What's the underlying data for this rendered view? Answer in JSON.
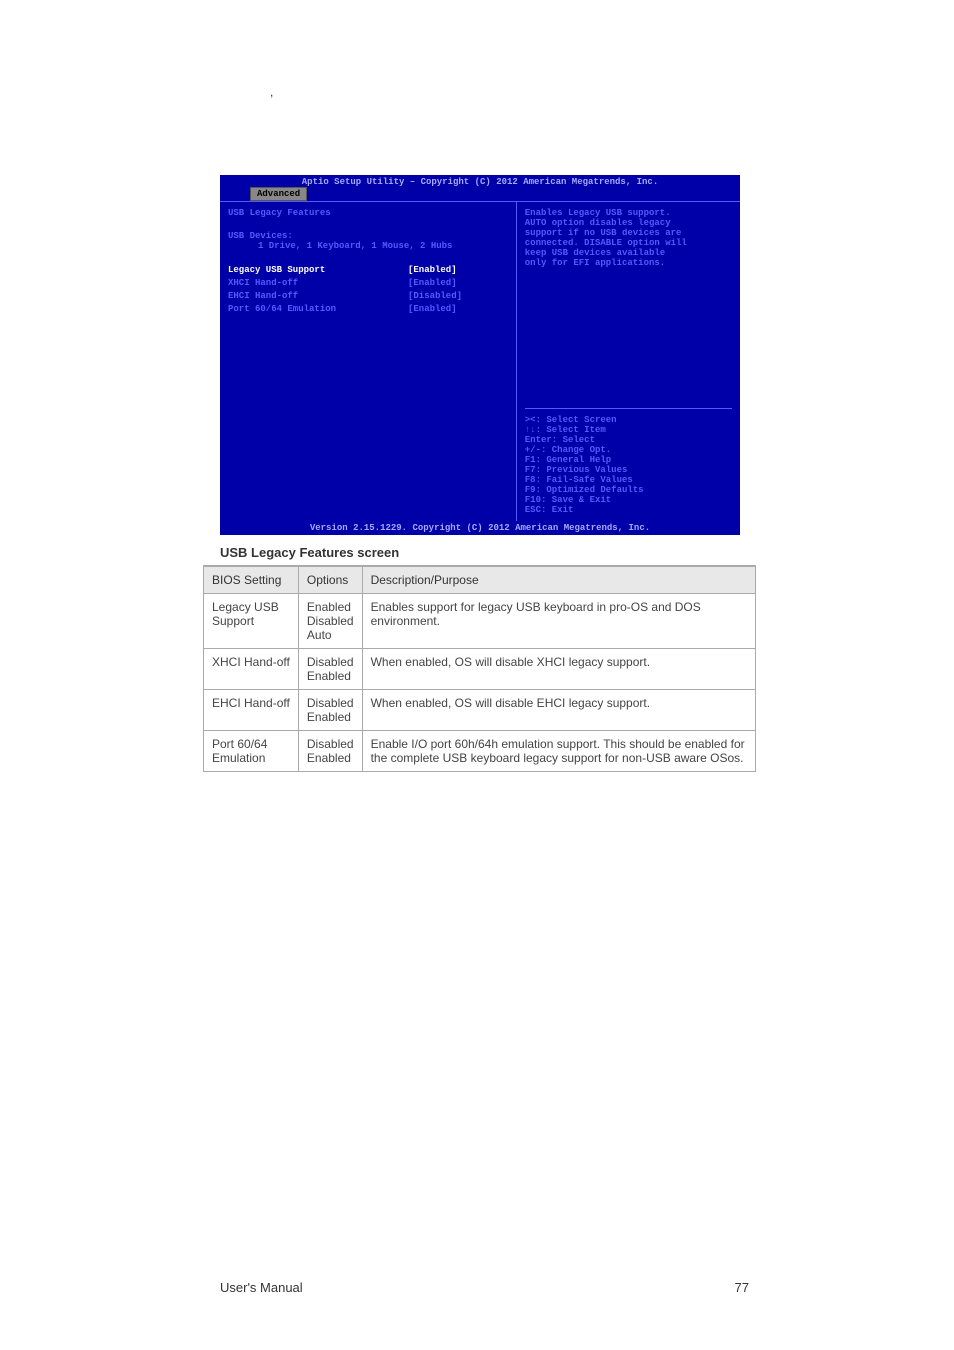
{
  "header_comma": ",",
  "bios": {
    "title": "Aptio Setup Utility – Copyright (C) 2012 American Megatrends, Inc.",
    "tab": "Advanced",
    "section_header": "USB Legacy Features",
    "devices_label": "USB Devices:",
    "devices_detail": "1 Drive, 1 Keyboard, 1 Mouse, 2 Hubs",
    "items": [
      {
        "label": "Legacy USB Support",
        "value": "[Enabled]",
        "hl": true
      },
      {
        "label": "XHCI Hand-off",
        "value": "[Enabled]",
        "hl": false
      },
      {
        "label": "EHCI Hand-off",
        "value": "[Disabled]",
        "hl": false
      },
      {
        "label": "Port 60/64 Emulation",
        "value": "[Enabled]",
        "hl": false
      }
    ],
    "help": "Enables Legacy USB support.\nAUTO option disables legacy\nsupport if no USB devices are\nconnected. DISABLE option will\nkeep USB devices available\nonly for EFI applications.",
    "nav": [
      "><: Select Screen",
      "↑↓: Select Item",
      "Enter: Select",
      "+/-: Change Opt.",
      "F1: General Help",
      "F7: Previous Values",
      "F8: Fail-Safe Values",
      "F9: Optimized Defaults",
      "F10: Save & Exit",
      "ESC: Exit"
    ],
    "footer": "Version 2.15.1229. Copyright (C) 2012 American Megatrends, Inc."
  },
  "table": {
    "headers": [
      "BIOS Setting",
      "Options",
      "Description/Purpose"
    ],
    "rows": [
      {
        "setting": "Legacy USB Support",
        "options": "Enabled\nDisabled\nAuto",
        "desc": "Enables support for legacy USB keyboard in pro-OS and DOS environment."
      },
      {
        "setting": "XHCI Hand-off",
        "options": "Disabled\nEnabled",
        "desc": "When enabled, OS will disable XHCI legacy support."
      },
      {
        "setting": "EHCI Hand-off",
        "options": "Disabled\nEnabled",
        "desc": "When enabled, OS will disable EHCI legacy support."
      },
      {
        "setting": "Port 60/64 Emulation",
        "options": "Disabled\nEnabled",
        "desc": "Enable I/O port 60h/64h emulation support. This should be enabled for the complete USB keyboard legacy support for non-USB aware OSos."
      }
    ]
  },
  "section_title_text": "USB Legacy Features screen",
  "footer_text": "User's Manual",
  "page_number": "77"
}
